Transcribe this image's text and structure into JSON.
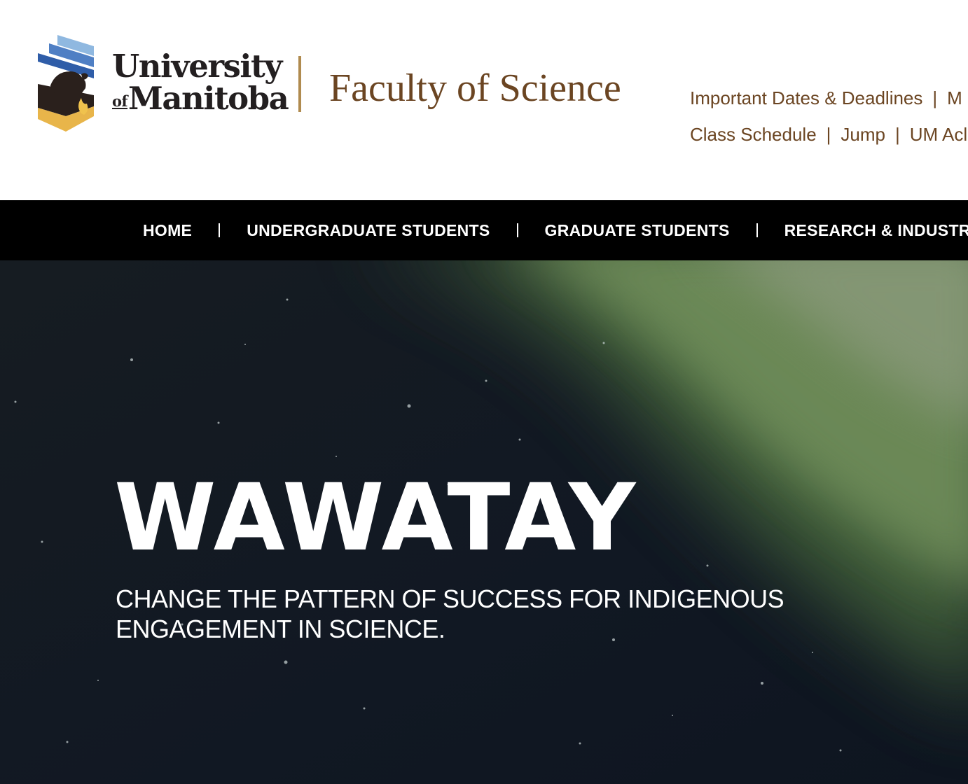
{
  "header": {
    "university_line1": "University",
    "university_of": "of",
    "university_line2": "Manitoba",
    "faculty_title": "Faculty of Science",
    "quick_links": {
      "row1": [
        "Important Dates & Deadlines",
        "M"
      ],
      "row2": [
        "Class Schedule",
        "Jump",
        "UM Acl"
      ],
      "separator": "|"
    }
  },
  "nav": {
    "items": [
      "HOME",
      "UNDERGRADUATE STUDENTS",
      "GRADUATE STUDENTS",
      "RESEARCH & INDUSTRY"
    ]
  },
  "hero": {
    "title": "WAWATAY",
    "subtitle": "CHANGE THE PATTERN OF SUCCESS FOR INDIGENOUS ENGAGEMENT IN SCIENCE.",
    "background_icon": "northern-lights-image"
  },
  "colors": {
    "brand_brown": "#6b4522",
    "divider_gold": "#b08b4f",
    "nav_bg": "#000000",
    "hero_dark": "#141b24",
    "aurora_green": "#6f8d5a",
    "crest_blue": "#2f5da8",
    "crest_light_blue": "#8fb8e0",
    "crest_gold": "#e8b54a",
    "crest_dark": "#2a201c"
  }
}
